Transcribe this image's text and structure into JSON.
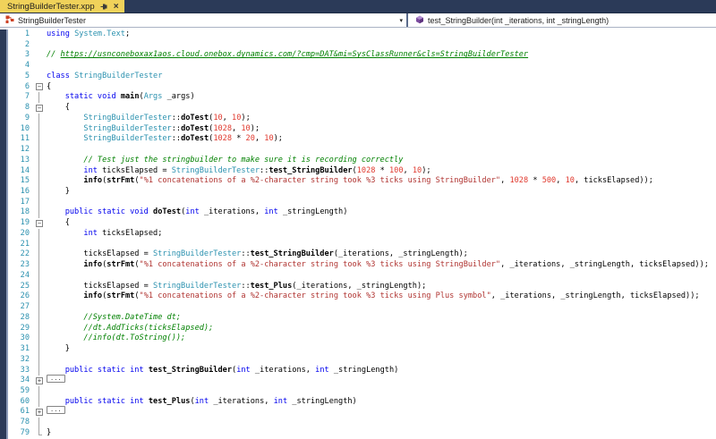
{
  "window": {
    "tab_title": "StringBuilderTester.xpp",
    "close_glyph": "×",
    "chevron_glyph": "▾"
  },
  "navbar": {
    "scope_label": "StringBuilderTester",
    "member_label": "test_StringBuilder(int _iterations, int _stringLength)"
  },
  "colors": {
    "chrome_navy": "#2b3a58",
    "tab_yellow": "#f0d25a",
    "keyword_blue": "#0000ee",
    "type_teal": "#2b91af",
    "string_red": "#b03431",
    "number_red": "#e0392e",
    "comment_green": "#008000",
    "line_number_teal": "#2b91af",
    "class_icon_orange": "#cc4125",
    "method_icon_purple": "#7a4a9e"
  },
  "code": {
    "lines": [
      {
        "n": 1,
        "fold": "",
        "t": [
          [
            "kw",
            "using"
          ],
          [
            "pl",
            " "
          ],
          [
            "ty",
            "System.Text"
          ],
          [
            "pl",
            ";"
          ]
        ]
      },
      {
        "n": 2,
        "fold": "",
        "t": []
      },
      {
        "n": 3,
        "fold": "",
        "t": [
          [
            "com",
            "// "
          ],
          [
            "link",
            "https://usnconeboxax1aos.cloud.onebox.dynamics.com/?cmp=DAT&mi=SysClassRunner&cls=StringBuilderTester"
          ]
        ]
      },
      {
        "n": 4,
        "fold": "",
        "t": []
      },
      {
        "n": 5,
        "fold": "",
        "t": [
          [
            "kw",
            "class"
          ],
          [
            "pl",
            " "
          ],
          [
            "ty",
            "StringBuilderTester"
          ]
        ]
      },
      {
        "n": 6,
        "fold": "minus",
        "t": [
          [
            "pl",
            "{"
          ]
        ]
      },
      {
        "n": 7,
        "fold": "line",
        "t": [
          [
            "pl",
            "    "
          ],
          [
            "kw",
            "static void"
          ],
          [
            "pl",
            " "
          ],
          [
            "meth",
            "main"
          ],
          [
            "pl",
            "("
          ],
          [
            "ty",
            "Args"
          ],
          [
            "pl",
            " _args)"
          ]
        ]
      },
      {
        "n": 8,
        "fold": "minus",
        "t": [
          [
            "pl",
            "    {"
          ]
        ]
      },
      {
        "n": 9,
        "fold": "line",
        "t": [
          [
            "pl",
            "        "
          ],
          [
            "ty",
            "StringBuilderTester"
          ],
          [
            "pl",
            "::"
          ],
          [
            "meth",
            "doTest"
          ],
          [
            "pl",
            "("
          ],
          [
            "num",
            "10"
          ],
          [
            "pl",
            ", "
          ],
          [
            "num",
            "10"
          ],
          [
            "pl",
            ");"
          ]
        ]
      },
      {
        "n": 10,
        "fold": "line",
        "t": [
          [
            "pl",
            "        "
          ],
          [
            "ty",
            "StringBuilderTester"
          ],
          [
            "pl",
            "::"
          ],
          [
            "meth",
            "doTest"
          ],
          [
            "pl",
            "("
          ],
          [
            "num",
            "1028"
          ],
          [
            "pl",
            ", "
          ],
          [
            "num",
            "10"
          ],
          [
            "pl",
            ");"
          ]
        ]
      },
      {
        "n": 11,
        "fold": "line",
        "t": [
          [
            "pl",
            "        "
          ],
          [
            "ty",
            "StringBuilderTester"
          ],
          [
            "pl",
            "::"
          ],
          [
            "meth",
            "doTest"
          ],
          [
            "pl",
            "("
          ],
          [
            "num",
            "1028"
          ],
          [
            "pl",
            " * "
          ],
          [
            "num",
            "20"
          ],
          [
            "pl",
            ", "
          ],
          [
            "num",
            "10"
          ],
          [
            "pl",
            ");"
          ]
        ]
      },
      {
        "n": 12,
        "fold": "line",
        "t": []
      },
      {
        "n": 13,
        "fold": "line",
        "t": [
          [
            "pl",
            "        "
          ],
          [
            "com",
            "// Test just the stringbuilder to make sure it is recording correctly"
          ]
        ]
      },
      {
        "n": 14,
        "fold": "line",
        "t": [
          [
            "pl",
            "        "
          ],
          [
            "kw",
            "int"
          ],
          [
            "pl",
            " ticksElapsed = "
          ],
          [
            "ty",
            "StringBuilderTester"
          ],
          [
            "pl",
            "::"
          ],
          [
            "meth",
            "test_StringBuilder"
          ],
          [
            "pl",
            "("
          ],
          [
            "num",
            "1028"
          ],
          [
            "pl",
            " * "
          ],
          [
            "num",
            "100"
          ],
          [
            "pl",
            ", "
          ],
          [
            "num",
            "10"
          ],
          [
            "pl",
            ");"
          ]
        ]
      },
      {
        "n": 15,
        "fold": "line",
        "t": [
          [
            "pl",
            "        "
          ],
          [
            "meth",
            "info"
          ],
          [
            "pl",
            "("
          ],
          [
            "meth",
            "strFmt"
          ],
          [
            "pl",
            "("
          ],
          [
            "str",
            "\"%1 concatenations of a %2-character string took %3 ticks using StringBuilder\""
          ],
          [
            "pl",
            ", "
          ],
          [
            "num",
            "1028"
          ],
          [
            "pl",
            " * "
          ],
          [
            "num",
            "500"
          ],
          [
            "pl",
            ", "
          ],
          [
            "num",
            "10"
          ],
          [
            "pl",
            ", ticksElapsed));"
          ]
        ]
      },
      {
        "n": 16,
        "fold": "line",
        "t": [
          [
            "pl",
            "    }"
          ]
        ]
      },
      {
        "n": 17,
        "fold": "line",
        "t": []
      },
      {
        "n": 18,
        "fold": "line",
        "t": [
          [
            "pl",
            "    "
          ],
          [
            "kw",
            "public static void"
          ],
          [
            "pl",
            " "
          ],
          [
            "meth",
            "doTest"
          ],
          [
            "pl",
            "("
          ],
          [
            "kw",
            "int"
          ],
          [
            "pl",
            " _iterations, "
          ],
          [
            "kw",
            "int"
          ],
          [
            "pl",
            " _stringLength)"
          ]
        ]
      },
      {
        "n": 19,
        "fold": "minus",
        "t": [
          [
            "pl",
            "    {"
          ]
        ]
      },
      {
        "n": 20,
        "fold": "line",
        "t": [
          [
            "pl",
            "        "
          ],
          [
            "kw",
            "int"
          ],
          [
            "pl",
            " ticksElapsed;"
          ]
        ]
      },
      {
        "n": 21,
        "fold": "line",
        "t": []
      },
      {
        "n": 22,
        "fold": "line",
        "t": [
          [
            "pl",
            "        ticksElapsed = "
          ],
          [
            "ty",
            "StringBuilderTester"
          ],
          [
            "pl",
            "::"
          ],
          [
            "meth",
            "test_StringBuilder"
          ],
          [
            "pl",
            "(_iterations, _stringLength);"
          ]
        ]
      },
      {
        "n": 23,
        "fold": "line",
        "t": [
          [
            "pl",
            "        "
          ],
          [
            "meth",
            "info"
          ],
          [
            "pl",
            "("
          ],
          [
            "meth",
            "strFmt"
          ],
          [
            "pl",
            "("
          ],
          [
            "str",
            "\"%1 concatenations of a %2-character string took %3 ticks using StringBuilder\""
          ],
          [
            "pl",
            ", _iterations, _stringLength, ticksElapsed));"
          ]
        ]
      },
      {
        "n": 24,
        "fold": "line",
        "t": []
      },
      {
        "n": 25,
        "fold": "line",
        "t": [
          [
            "pl",
            "        ticksElapsed = "
          ],
          [
            "ty",
            "StringBuilderTester"
          ],
          [
            "pl",
            "::"
          ],
          [
            "meth",
            "test_Plus"
          ],
          [
            "pl",
            "(_iterations, _stringLength);"
          ]
        ]
      },
      {
        "n": 26,
        "fold": "line",
        "t": [
          [
            "pl",
            "        "
          ],
          [
            "meth",
            "info"
          ],
          [
            "pl",
            "("
          ],
          [
            "meth",
            "strFmt"
          ],
          [
            "pl",
            "("
          ],
          [
            "str",
            "\"%1 concatenations of a %2-character string took %3 ticks using Plus symbol\""
          ],
          [
            "pl",
            ", _iterations, _stringLength, ticksElapsed));"
          ]
        ]
      },
      {
        "n": 27,
        "fold": "line",
        "t": []
      },
      {
        "n": 28,
        "fold": "line",
        "t": [
          [
            "pl",
            "        "
          ],
          [
            "com",
            "//System.DateTime dt;"
          ]
        ]
      },
      {
        "n": 29,
        "fold": "line",
        "t": [
          [
            "pl",
            "        "
          ],
          [
            "com",
            "//dt.AddTicks(ticksElapsed);"
          ]
        ]
      },
      {
        "n": 30,
        "fold": "line",
        "t": [
          [
            "pl",
            "        "
          ],
          [
            "com",
            "//info(dt.ToString());"
          ]
        ]
      },
      {
        "n": 31,
        "fold": "line",
        "t": [
          [
            "pl",
            "    }"
          ]
        ]
      },
      {
        "n": 32,
        "fold": "line",
        "t": []
      },
      {
        "n": 33,
        "fold": "line",
        "t": [
          [
            "pl",
            "    "
          ],
          [
            "kw",
            "public static int"
          ],
          [
            "pl",
            " "
          ],
          [
            "meth",
            "test_StringBuilder"
          ],
          [
            "pl",
            "("
          ],
          [
            "kw",
            "int"
          ],
          [
            "pl",
            " _iterations, "
          ],
          [
            "kw",
            "int"
          ],
          [
            "pl",
            " _stringLength)"
          ]
        ]
      },
      {
        "n": 34,
        "fold": "plus",
        "t": [
          [
            "box",
            "..."
          ]
        ]
      },
      {
        "n": 59,
        "fold": "line",
        "t": []
      },
      {
        "n": 60,
        "fold": "line",
        "t": [
          [
            "pl",
            "    "
          ],
          [
            "kw",
            "public static int"
          ],
          [
            "pl",
            " "
          ],
          [
            "meth",
            "test_Plus"
          ],
          [
            "pl",
            "("
          ],
          [
            "kw",
            "int"
          ],
          [
            "pl",
            " _iterations, "
          ],
          [
            "kw",
            "int"
          ],
          [
            "pl",
            " _stringLength)"
          ]
        ]
      },
      {
        "n": 61,
        "fold": "plus",
        "t": [
          [
            "box",
            "..."
          ]
        ]
      },
      {
        "n": 78,
        "fold": "line",
        "t": []
      },
      {
        "n": 79,
        "fold": "end",
        "t": [
          [
            "pl",
            "}"
          ]
        ]
      }
    ]
  }
}
